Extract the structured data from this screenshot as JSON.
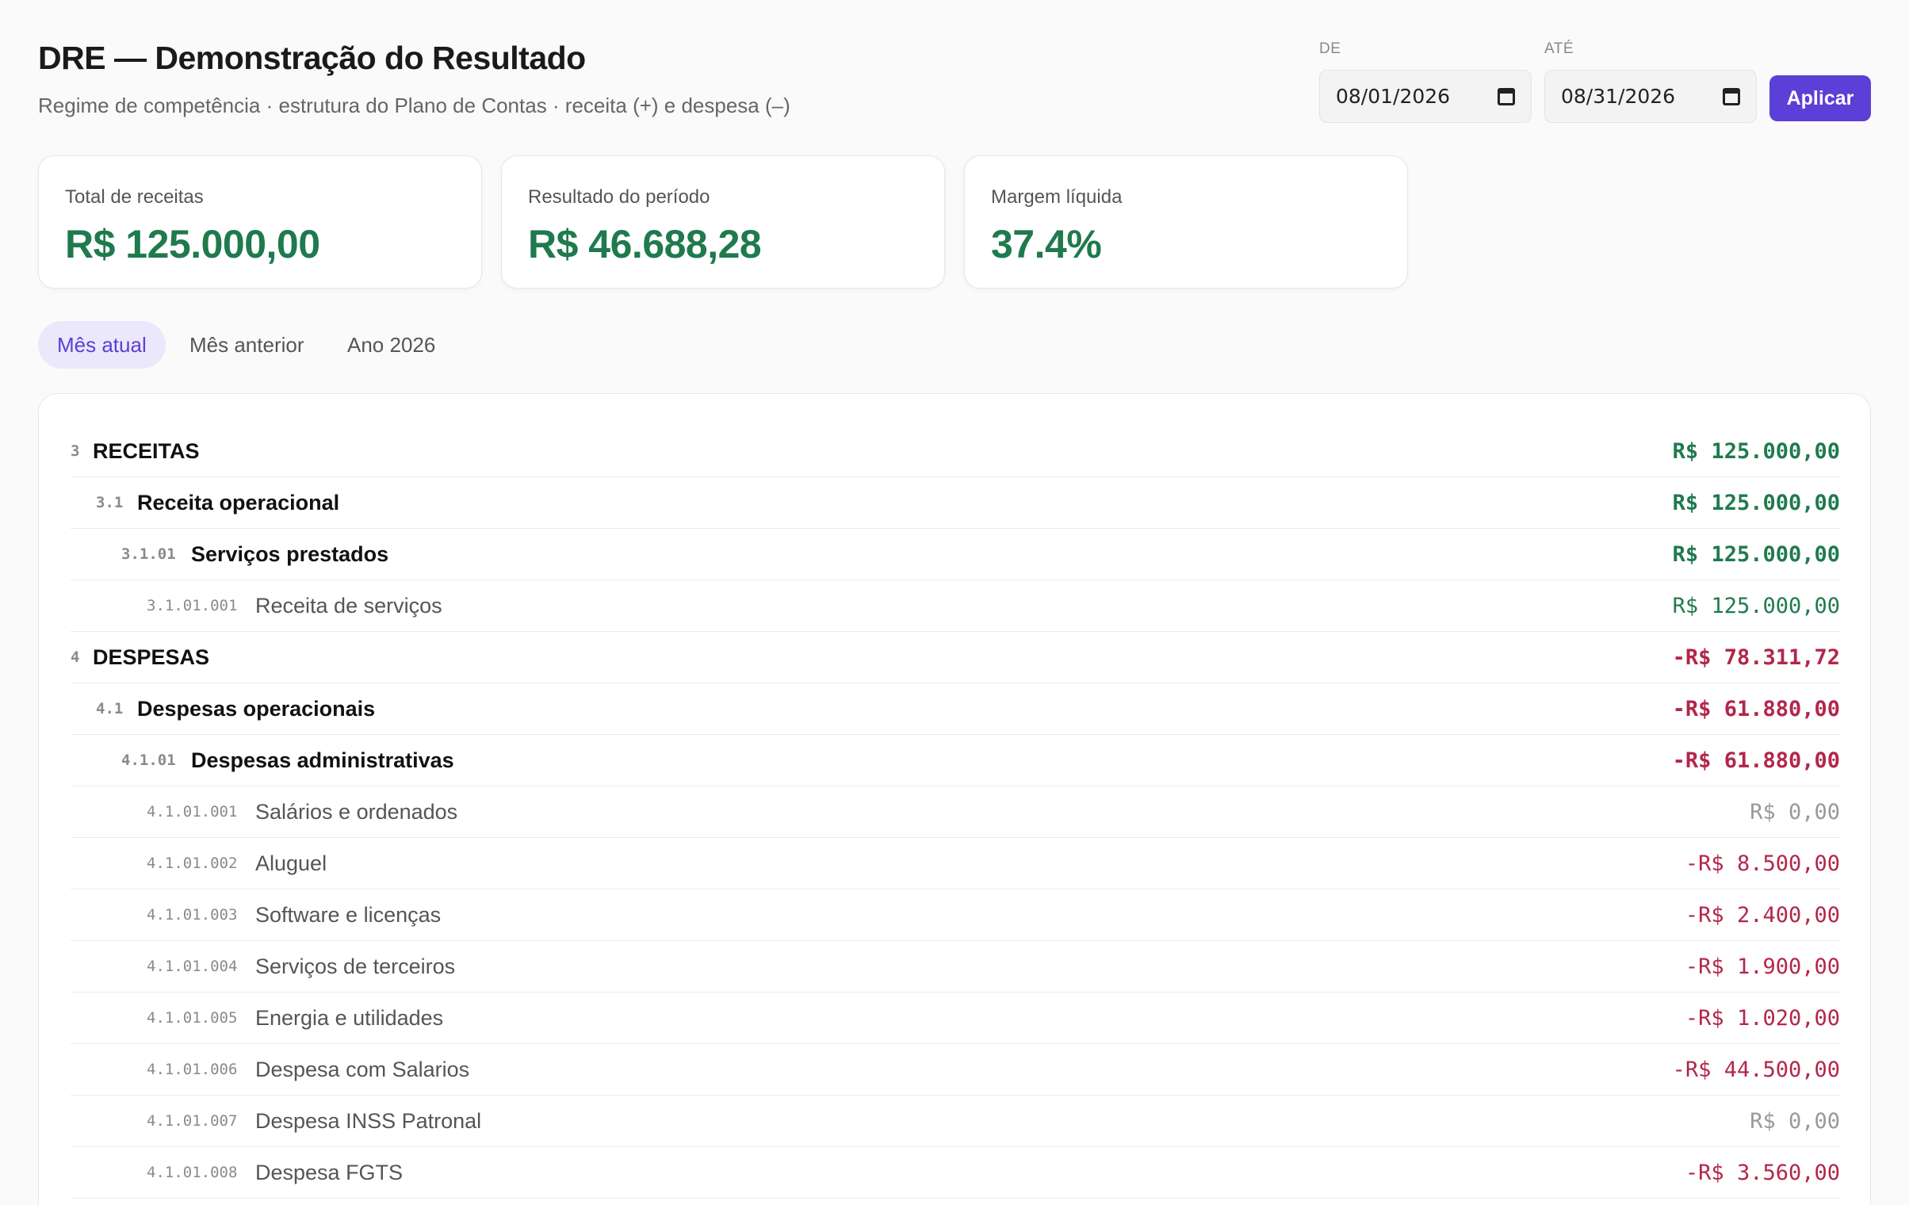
{
  "header": {
    "title": "DRE — Demonstração do Resultado",
    "subtitle": "Regime de competência · estrutura do Plano de Contas · receita (+) e despesa (–)"
  },
  "filters": {
    "from_label": "DE",
    "from_value": "08/01/2026",
    "to_label": "ATÉ",
    "to_value": "08/31/2026",
    "apply_label": "Aplicar"
  },
  "kpis": [
    {
      "label": "Total de receitas",
      "value": "R$ 125.000,00"
    },
    {
      "label": "Resultado do período",
      "value": "R$ 46.688,28"
    },
    {
      "label": "Margem líquida",
      "value": "37.4%"
    }
  ],
  "tabs": [
    {
      "label": "Mês atual",
      "active": true
    },
    {
      "label": "Mês anterior",
      "active": false
    },
    {
      "label": "Ano 2026",
      "active": false
    }
  ],
  "rows": [
    {
      "code": "3",
      "name": "RECEITAS",
      "amount": "R$ 125.000,00"
    },
    {
      "code": "3.1",
      "name": "Receita operacional",
      "amount": "R$ 125.000,00"
    },
    {
      "code": "3.1.01",
      "name": "Serviços prestados",
      "amount": "R$ 125.000,00"
    },
    {
      "code": "3.1.01.001",
      "name": "Receita de serviços",
      "amount": "R$ 125.000,00"
    },
    {
      "code": "4",
      "name": "DESPESAS",
      "amount": "-R$ 78.311,72"
    },
    {
      "code": "4.1",
      "name": "Despesas operacionais",
      "amount": "-R$ 61.880,00"
    },
    {
      "code": "4.1.01",
      "name": "Despesas administrativas",
      "amount": "-R$ 61.880,00"
    },
    {
      "code": "4.1.01.001",
      "name": "Salários e ordenados",
      "amount": "R$ 0,00"
    },
    {
      "code": "4.1.01.002",
      "name": "Aluguel",
      "amount": "-R$ 8.500,00"
    },
    {
      "code": "4.1.01.003",
      "name": "Software e licenças",
      "amount": "-R$ 2.400,00"
    },
    {
      "code": "4.1.01.004",
      "name": "Serviços de terceiros",
      "amount": "-R$ 1.900,00"
    },
    {
      "code": "4.1.01.005",
      "name": "Energia e utilidades",
      "amount": "-R$ 1.020,00"
    },
    {
      "code": "4.1.01.006",
      "name": "Despesa com Salarios",
      "amount": "-R$ 44.500,00"
    },
    {
      "code": "4.1.01.007",
      "name": "Despesa INSS Patronal",
      "amount": "R$ 0,00"
    },
    {
      "code": "4.1.01.008",
      "name": "Despesa FGTS",
      "amount": "-R$ 3.560,00"
    }
  ],
  "colors": {
    "accent": "#5b3fd6",
    "positive": "#1f7a4d",
    "negative": "#b3264a",
    "zero": "#999999"
  }
}
